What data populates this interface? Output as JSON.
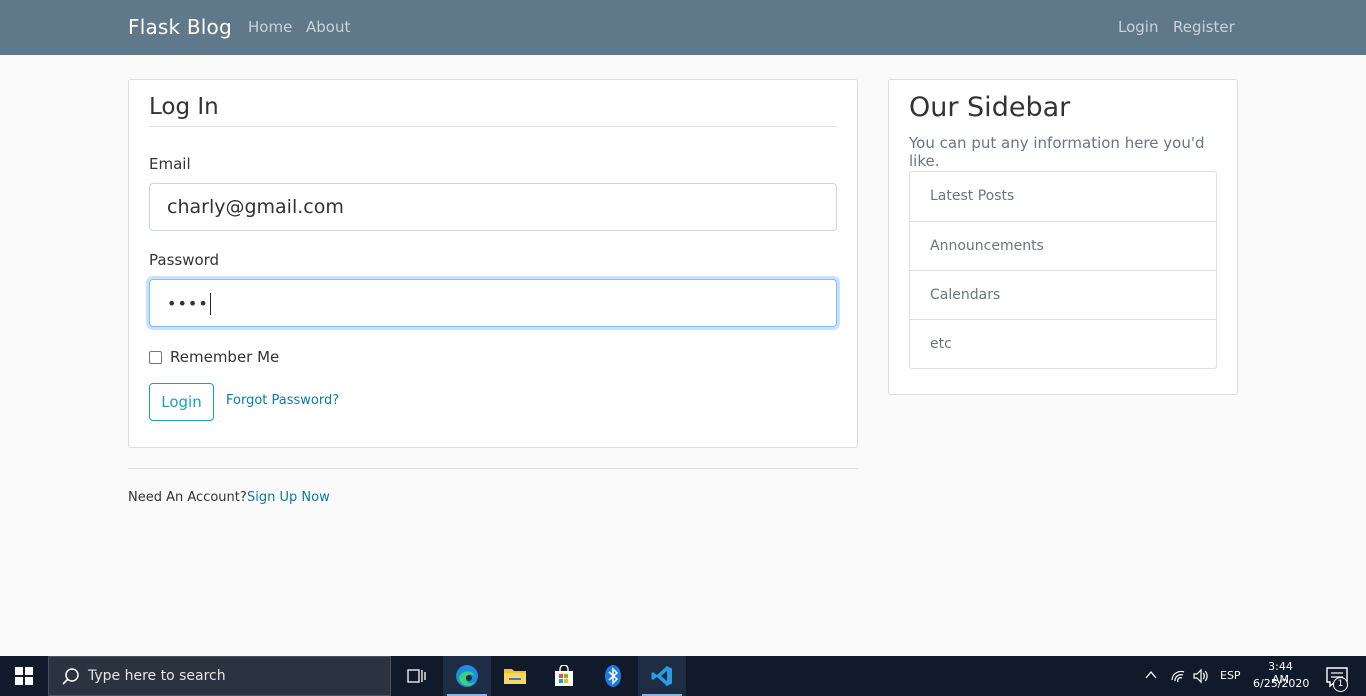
{
  "navbar": {
    "brand": "Flask Blog",
    "left_links": [
      "Home",
      "About"
    ],
    "right_links": [
      "Login",
      "Register"
    ]
  },
  "login_form": {
    "legend": "Log In",
    "email_label": "Email",
    "email_value": "charly@gmail.com",
    "password_label": "Password",
    "password_value": "••••",
    "remember_label": "Remember Me",
    "remember_checked": false,
    "submit_label": "Login",
    "forgot_link": "Forgot Password?"
  },
  "footer": {
    "need_account": "Need An Account?",
    "signup_link": "Sign Up Now"
  },
  "sidebar": {
    "title": "Our Sidebar",
    "text": "You can put any information here you'd like.",
    "items": [
      "Latest Posts",
      "Announcements",
      "Calendars",
      "etc"
    ]
  },
  "taskbar": {
    "search_placeholder": "Type here to search",
    "apps": [
      "task-view-icon",
      "edge-icon",
      "file-explorer-icon",
      "store-icon",
      "bluetooth-icon",
      "vscode-icon"
    ],
    "language": "ESP",
    "time": "3:44 AM",
    "date": "6/25/2020",
    "notification_count": "1"
  },
  "colors": {
    "navbar": "#5f788a",
    "accent": "#17a2b8",
    "link": "#0a7aa8",
    "taskbar": "#101a2a"
  }
}
